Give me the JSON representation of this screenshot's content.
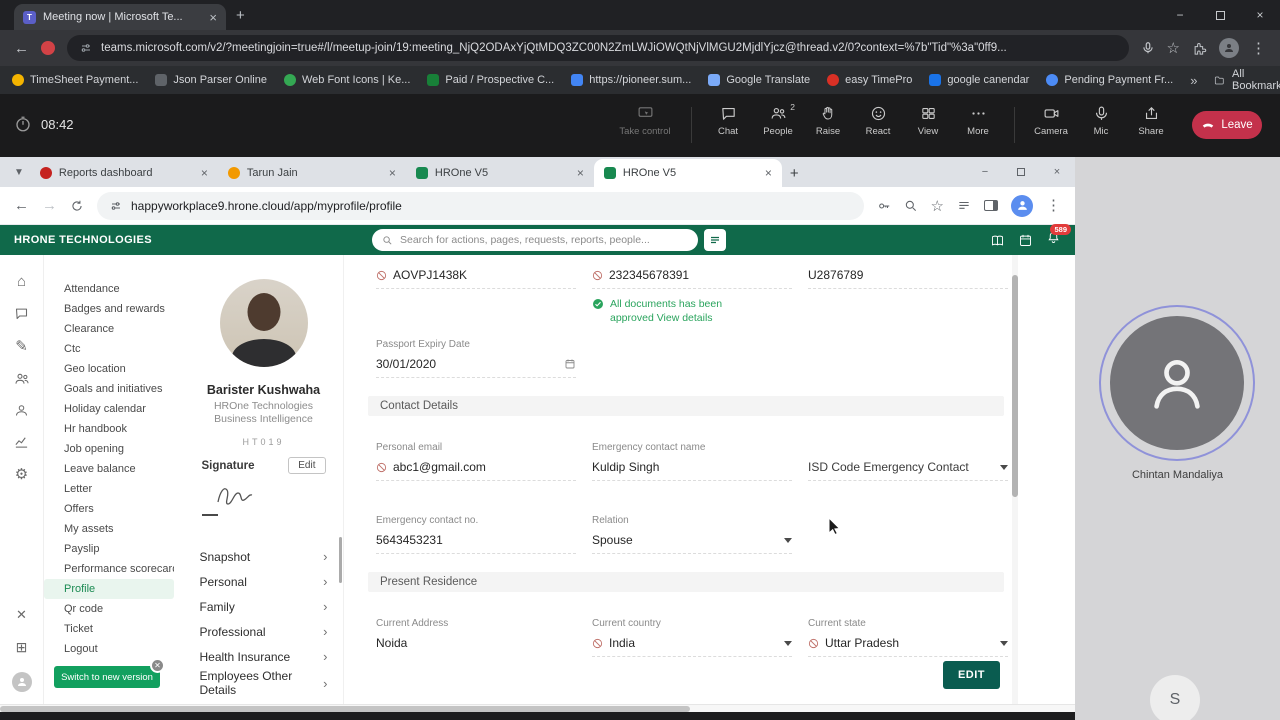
{
  "colors": {
    "hrone_green": "#10694A",
    "leave_red": "#C4314B",
    "approval_green": "#2AA45D",
    "edit_button_green": "#0A5C50",
    "active_nav_green": "#1B8A52",
    "avatar_ring_purple": "#8F92D9",
    "badge_red": "#E23B3B"
  },
  "browser": {
    "tab_title": "Meeting now | Microsoft Te...",
    "url": "teams.microsoft.com/v2/?meetingjoin=true#/l/meetup-join/19:meeting_NjQ2ODAxYjQtMDQ3ZC00N2ZmLWJiOWQtNjVlMGU2MjdlYjcz@thread.v2/0?context=%7b\"Tid\"%3a\"0ff9...",
    "bookmarks": [
      "TimeSheet Payment...",
      "Json Parser Online",
      "Web Font Icons | Ke...",
      "Paid / Prospective C...",
      "https://pioneer.sum...",
      "Google Translate",
      "easy TimePro",
      "google canendar",
      "Pending Payment Fr..."
    ],
    "all_bookmarks": "All Bookmarks"
  },
  "meeting": {
    "timer": "08:42",
    "take_control": "Take control",
    "buttons": [
      "Chat",
      "People",
      "Raise",
      "React",
      "View",
      "More"
    ],
    "people_count": "2",
    "device_buttons": [
      "Camera",
      "Mic",
      "Share"
    ],
    "leave": "Leave"
  },
  "shared": {
    "tabs": [
      "Reports dashboard",
      "Tarun Jain",
      "HROne V5",
      "HROne V5"
    ],
    "url": "happyworkplace9.hrone.cloud/app/myprofile/profile",
    "app": {
      "brand": "HRONE TECHNOLOGIES",
      "search_placeholder": "Search for actions, pages, requests, reports, people...",
      "notif_badge": "589",
      "nav": [
        "Attendance",
        "Badges and rewards",
        "Clearance",
        "Ctc",
        "Geo location",
        "Goals and initiatives",
        "Holiday calendar",
        "Hr handbook",
        "Job opening",
        "Leave balance",
        "Letter",
        "Offers",
        "My assets",
        "Payslip",
        "Performance scorecard",
        "Profile",
        "Qr code",
        "Ticket",
        "Logout"
      ],
      "active_nav": "Profile",
      "switch_version": "Switch to new version",
      "profile": {
        "name": "Barister Kushwaha",
        "company": "HROne Technologies",
        "department": "Business Intelligence",
        "emp_code": "HT019",
        "signature_label": "Signature",
        "edit_label": "Edit",
        "menu": [
          "Snapshot",
          "Personal",
          "Family",
          "Professional",
          "Health Insurance",
          "Employees Other Details"
        ]
      },
      "content": {
        "doc_values": [
          "AOVPJ1438K",
          "232345678391",
          "U2876789"
        ],
        "approval_note": "All documents has been approved View details",
        "passport": {
          "label": "Passport Expiry Date",
          "value": "30/01/2020"
        },
        "section_contact": "Contact Details",
        "section_residence": "Present Residence",
        "personal_email": {
          "label": "Personal email",
          "value": "abc1@gmail.com"
        },
        "emergency_name": {
          "label": "Emergency contact name",
          "value": "Kuldip Singh"
        },
        "isd_code": {
          "label": "ISD Code Emergency Contact"
        },
        "emergency_no": {
          "label": "Emergency contact no.",
          "value": "5643453231"
        },
        "relation": {
          "label": "Relation",
          "value": "Spouse"
        },
        "current_address": {
          "label": "Current Address",
          "value": "Noida"
        },
        "current_country": {
          "label": "Current country",
          "value": "India"
        },
        "current_state": {
          "label": "Current state",
          "value": "Uttar Pradesh"
        },
        "edit_button": "EDIT"
      }
    }
  },
  "participants": {
    "main": "Chintan Mandaliya",
    "bubble": "S"
  }
}
